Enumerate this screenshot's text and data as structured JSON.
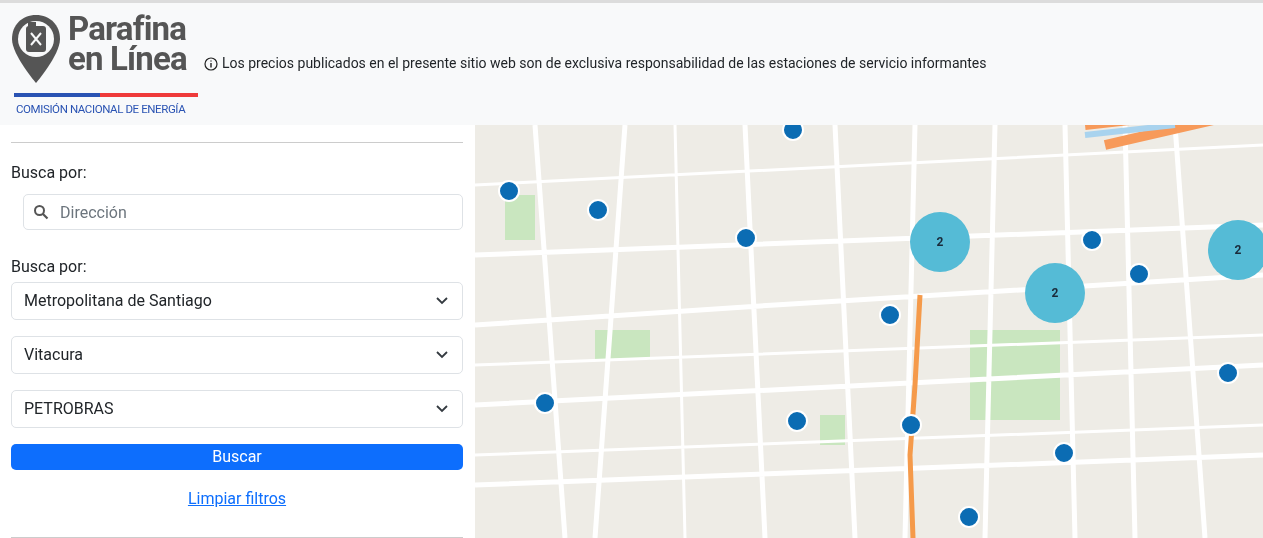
{
  "header": {
    "logo": {
      "title_line_1": "Parafina",
      "title_line_2": "en Línea",
      "subtitle": "COMISIÓN NACIONAL DE ENERGÍA"
    },
    "notice": "Los precios publicados en el presente sitio web son de exclusiva responsabilidad de las estaciones de servicio informantes"
  },
  "filters": {
    "address_label": "Busca por:",
    "address_search": {
      "placeholder": "Dirección"
    },
    "select_label": "Busca por:",
    "selects": [
      {
        "value": "Metropolitana de Santiago"
      },
      {
        "value": "Vitacura"
      },
      {
        "value": "PETROBRAS"
      }
    ],
    "search_button": "Buscar",
    "clear_link": "Limpiar filtros"
  },
  "map": {
    "clusters": [
      {
        "count": "2"
      },
      {
        "count": "2"
      },
      {
        "count": "2"
      }
    ]
  }
}
